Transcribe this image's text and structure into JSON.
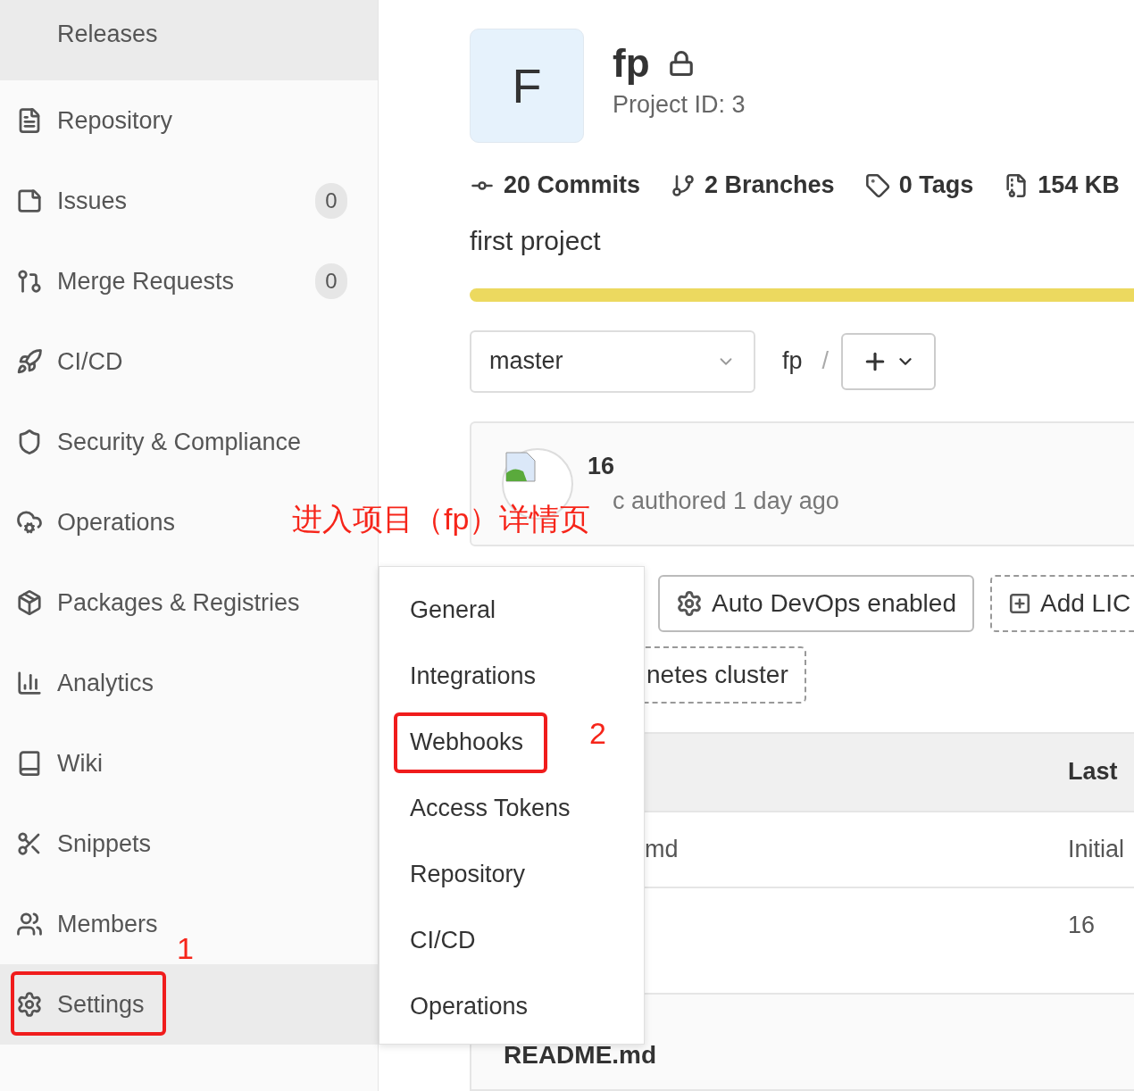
{
  "sidebar": {
    "items": [
      {
        "label": "Releases",
        "selected": true,
        "annotated": false
      },
      {
        "label": "Repository",
        "selected": false,
        "annotated": false
      },
      {
        "label": "Issues",
        "badge": "0",
        "selected": false,
        "annotated": false
      },
      {
        "label": "Merge Requests",
        "badge": "0",
        "selected": false,
        "annotated": false
      },
      {
        "label": "CI/CD",
        "selected": false,
        "annotated": false
      },
      {
        "label": "Security & Compliance",
        "selected": false,
        "annotated": false
      },
      {
        "label": "Operations",
        "selected": false,
        "annotated": false
      },
      {
        "label": "Packages & Registries",
        "selected": false,
        "annotated": false
      },
      {
        "label": "Analytics",
        "selected": false,
        "annotated": false
      },
      {
        "label": "Wiki",
        "selected": false,
        "annotated": false
      },
      {
        "label": "Snippets",
        "selected": false,
        "annotated": false
      },
      {
        "label": "Members",
        "selected": false,
        "annotated": false
      },
      {
        "label": "Settings",
        "selected": true,
        "annotated": true
      }
    ]
  },
  "project": {
    "avatar_letter": "F",
    "name": "fp",
    "private": true,
    "id_text": "Project ID: 3",
    "stats": [
      {
        "label": "20 Commits"
      },
      {
        "label": "2 Branches"
      },
      {
        "label": "0 Tags"
      },
      {
        "label": "154 KB"
      }
    ],
    "description": "first project"
  },
  "controls": {
    "branch": "master",
    "path": "fp",
    "separator": "/"
  },
  "last_commit": {
    "title": "16",
    "meta": "c authored 1 day ago"
  },
  "chips": [
    {
      "label": "Auto DevOps enabled",
      "kind": "solid"
    },
    {
      "label": "Add LIC",
      "kind": "dashed"
    },
    {
      "label": "netes cluster",
      "kind": "dashed"
    }
  ],
  "table": {
    "header": {
      "column_2": "Last"
    },
    "rows": [
      {
        "column_1": "md",
        "column_2": "Initial"
      },
      {
        "column_2": "16"
      }
    ]
  },
  "readme": {
    "title": "README.md"
  },
  "settings_menu": {
    "items": [
      {
        "label": "General",
        "annotated": false
      },
      {
        "label": "Integrations",
        "annotated": false
      },
      {
        "label": "Webhooks",
        "annotated": true
      },
      {
        "label": "Access Tokens",
        "annotated": false
      },
      {
        "label": "Repository",
        "annotated": false
      },
      {
        "label": "CI/CD",
        "annotated": false
      },
      {
        "label": "Operations",
        "annotated": false
      }
    ]
  },
  "annotations": [
    {
      "text": "进入项目（fp）详情页"
    },
    {
      "text": "1"
    },
    {
      "text": "2"
    }
  ]
}
